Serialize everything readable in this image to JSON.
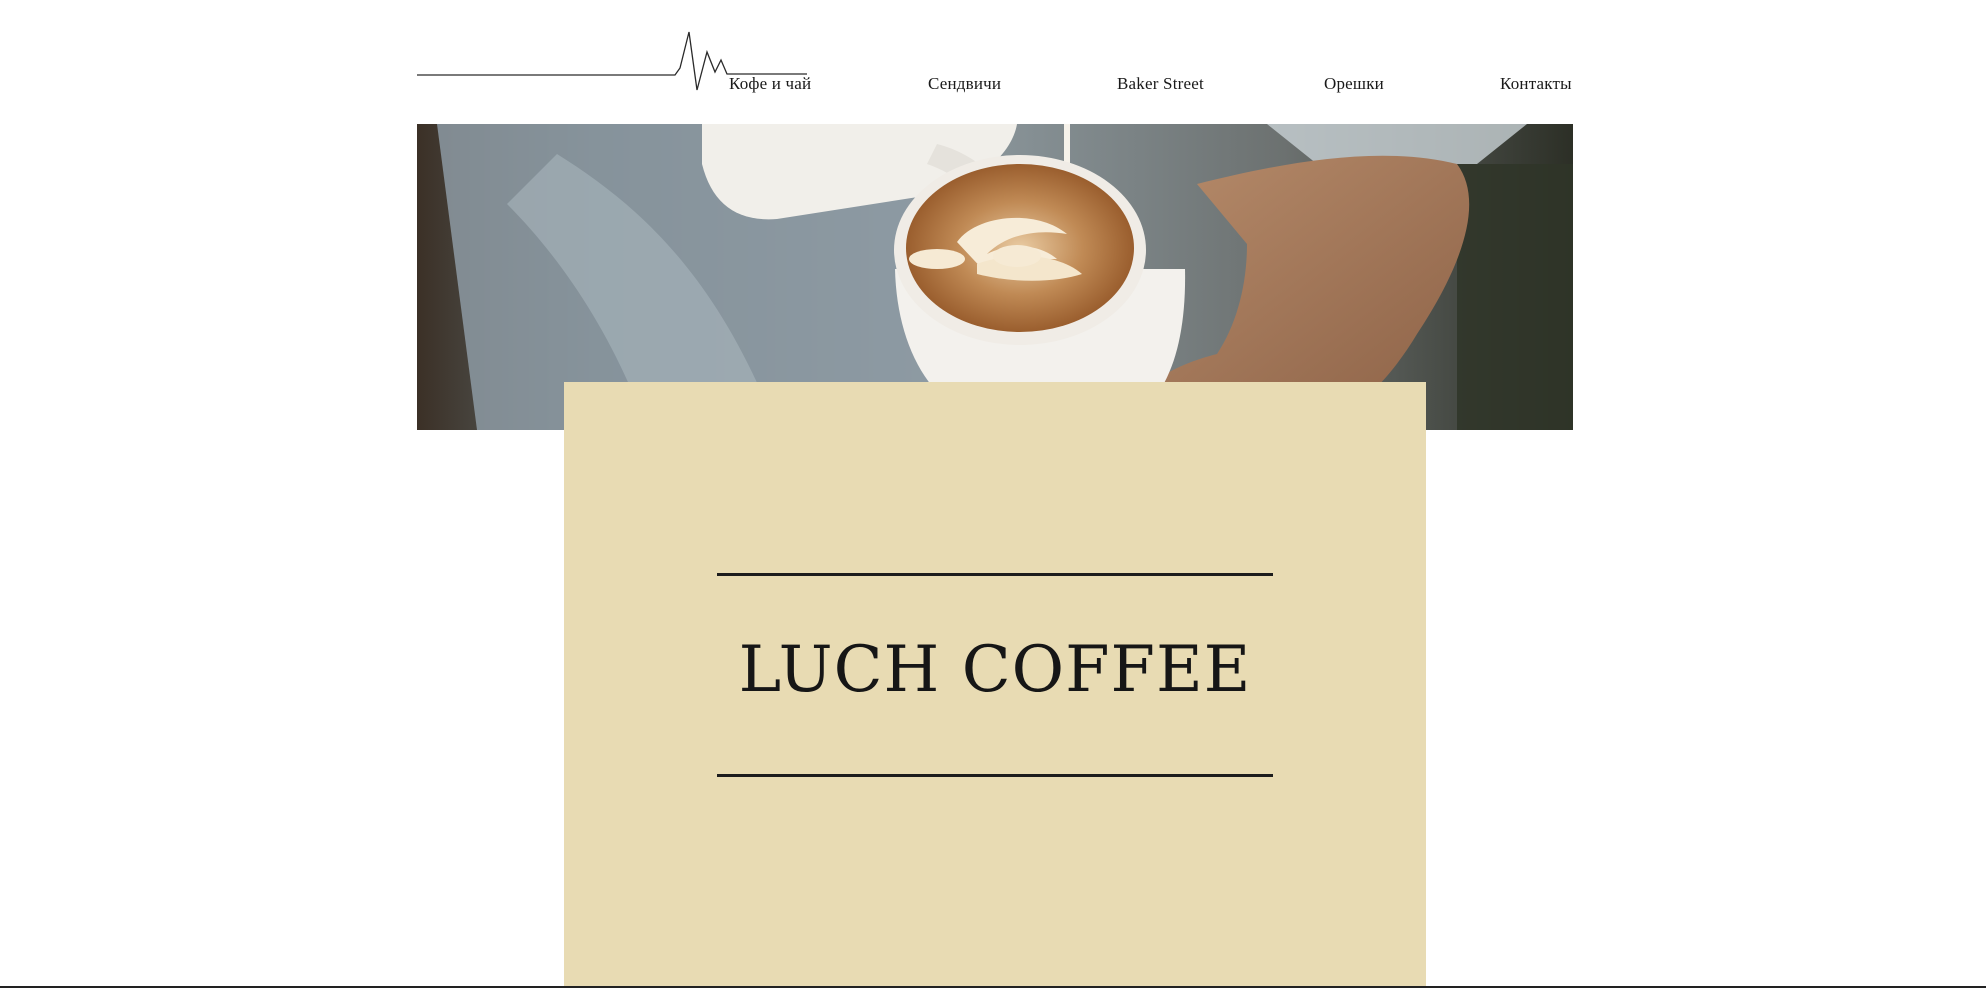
{
  "nav": {
    "items": [
      {
        "label": "Кофе и чай"
      },
      {
        "label": "Сендвичи"
      },
      {
        "label": "Baker Street"
      },
      {
        "label": "Орешки"
      },
      {
        "label": "Контакты"
      }
    ]
  },
  "hero": {
    "image": "latte-art-pour-photo"
  },
  "card": {
    "title": "LUCH COFFEE"
  },
  "colors": {
    "card_background": "#e8dbb3",
    "text": "#1a1a1a",
    "page_background": "#ffffff"
  },
  "icons": {
    "logo": "heartbeat-line-logo"
  }
}
